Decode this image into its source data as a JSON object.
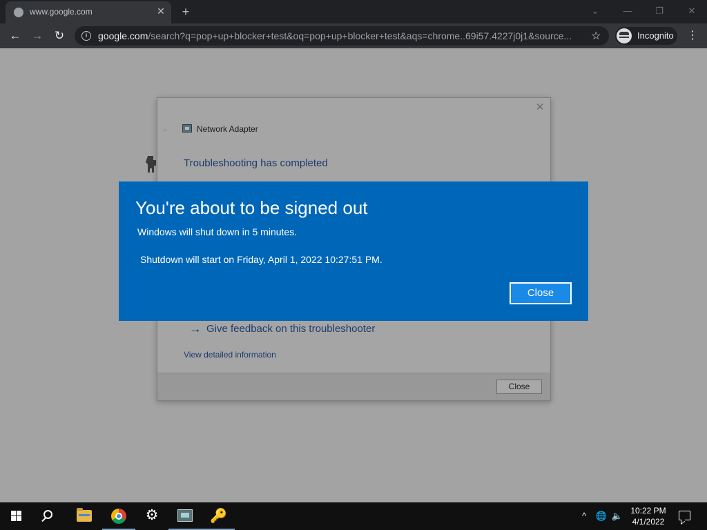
{
  "browser": {
    "tab_title": "www.google.com",
    "tab_close_icon": "✕",
    "new_tab_icon": "+",
    "url_host": "google.com",
    "url_path": "/search?q=pop+up+blocker+test&oq=pop+up+blocker+test&aqs=chrome..69i57.4227j0j1&source...",
    "incognito_label": "Incognito",
    "back_icon": "←",
    "forward_icon": "→",
    "reload_icon": "↻",
    "star_icon": "☆",
    "menu_icon": "⋮",
    "win_controls": {
      "tabsearch": "⌄",
      "minimize": "—",
      "restore": "❐",
      "close": "✕"
    }
  },
  "troubleshooter": {
    "title": "Network Adapter",
    "heading": "Troubleshooting has completed",
    "feedback_link": "Give feedback on this troubleshooter",
    "detail_link": "View detailed information",
    "close_button": "Close",
    "close_icon": "✕",
    "back_icon": "←",
    "feedback_arrow": "→"
  },
  "signout_dialog": {
    "title": "You're about to be signed out",
    "message": "Windows will shut down in 5 minutes.",
    "shutdown_time": "Shutdown will start on Friday, April 1, 2022 10:27:51 PM.",
    "close_button": "Close",
    "color": "#0067b8"
  },
  "taskbar": {
    "apps": [
      "start-icon",
      "search-icon",
      "file-explorer-icon",
      "chrome-icon",
      "settings-icon",
      "network-adapter-icon",
      "keys-icon"
    ],
    "tray_chevron": "^",
    "tray_network": "🌐",
    "tray_volume": "🔈",
    "clock_time": "10:22 PM",
    "clock_date": "4/1/2022",
    "gear_glyph": "⚙",
    "keys_glyph": "🔑"
  }
}
